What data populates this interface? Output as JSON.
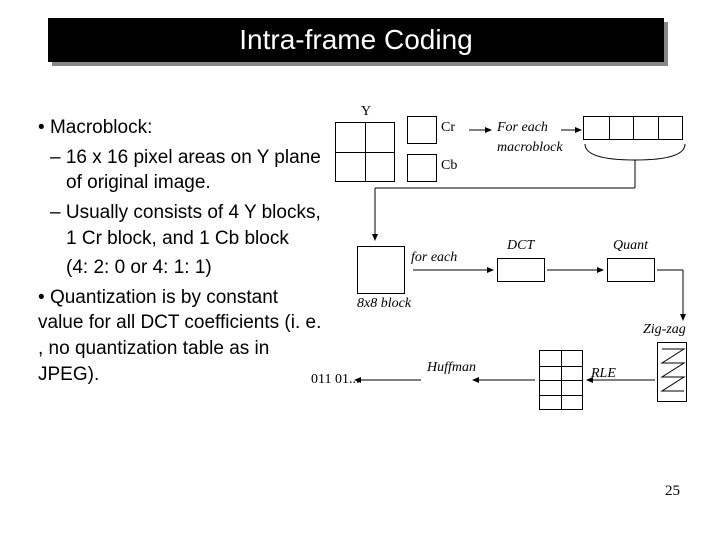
{
  "title": "Intra-frame Coding",
  "bullets": {
    "macroblock_label": "Macroblock:",
    "macroblock_sub1": "16 x 16 pixel areas on Y plane of original image.",
    "macroblock_sub2": "Usually consists of 4 Y blocks, 1 Cr block, and 1 Cb block",
    "macroblock_ratio": "(4: 2: 0 or 4: 1: 1)",
    "quantization": "Quantization is by constant value for all DCT coefficients (i. e. , no quantization table as in JPEG)."
  },
  "diagram": {
    "y_label": "Y",
    "cr_label": "Cr",
    "cb_label": "Cb",
    "for_each_mb1": "For each",
    "for_each_mb2": "macroblock",
    "for_each_block1": "for each",
    "for_each_block2": "8x8 block",
    "dct": "DCT",
    "quant": "Quant",
    "zigzag": "Zig-zag",
    "rle": "RLE",
    "huffman": "Huffman",
    "bitstream": "011 01..."
  },
  "page_number": "25"
}
